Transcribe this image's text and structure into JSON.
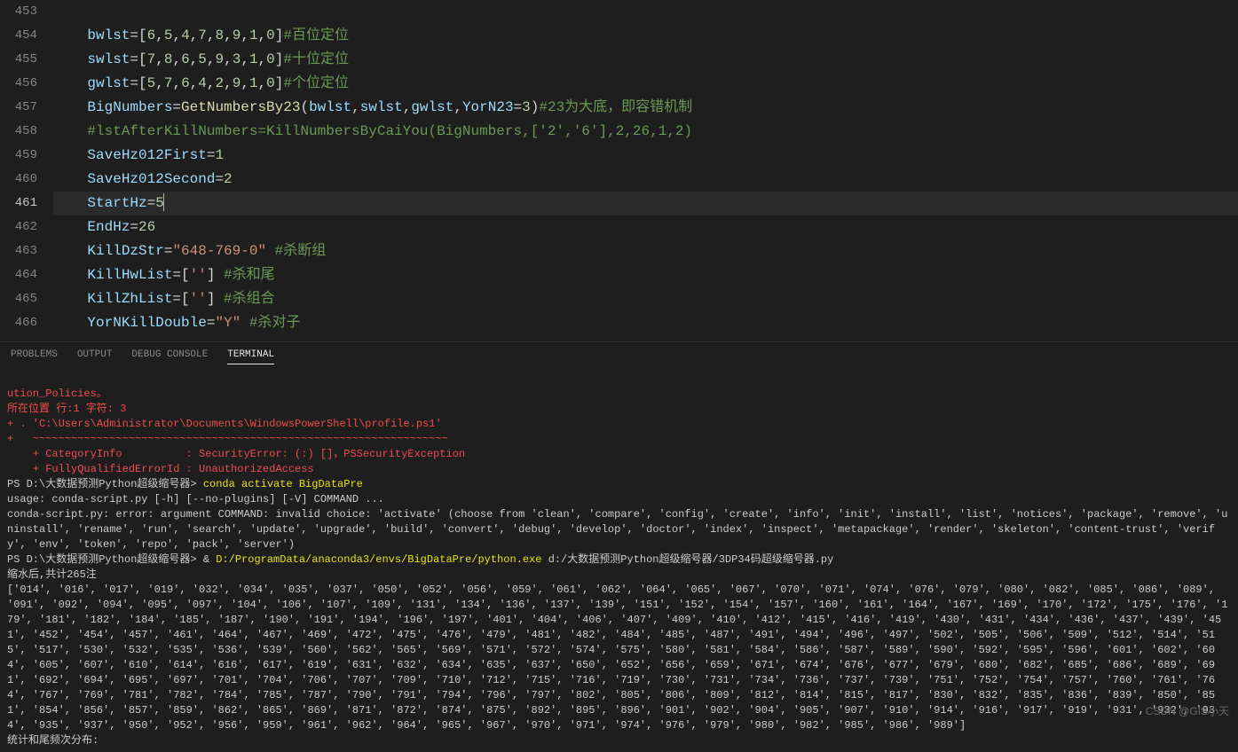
{
  "editor": {
    "lines": [
      {
        "num": "453",
        "tokens": []
      },
      {
        "num": "454",
        "tokens": [
          {
            "t": "bwlst",
            "c": "tk-var"
          },
          {
            "t": "=[",
            "c": "tk-op"
          },
          {
            "t": "6",
            "c": "tk-num"
          },
          {
            "t": ",",
            "c": "tk-op"
          },
          {
            "t": "5",
            "c": "tk-num"
          },
          {
            "t": ",",
            "c": "tk-op"
          },
          {
            "t": "4",
            "c": "tk-num"
          },
          {
            "t": ",",
            "c": "tk-op"
          },
          {
            "t": "7",
            "c": "tk-num"
          },
          {
            "t": ",",
            "c": "tk-op"
          },
          {
            "t": "8",
            "c": "tk-num"
          },
          {
            "t": ",",
            "c": "tk-op"
          },
          {
            "t": "9",
            "c": "tk-num"
          },
          {
            "t": ",",
            "c": "tk-op"
          },
          {
            "t": "1",
            "c": "tk-num"
          },
          {
            "t": ",",
            "c": "tk-op"
          },
          {
            "t": "0",
            "c": "tk-num"
          },
          {
            "t": "]",
            "c": "tk-op"
          },
          {
            "t": "#百位定位",
            "c": "tk-cmt"
          }
        ]
      },
      {
        "num": "455",
        "tokens": [
          {
            "t": "swlst",
            "c": "tk-var"
          },
          {
            "t": "=[",
            "c": "tk-op"
          },
          {
            "t": "7",
            "c": "tk-num"
          },
          {
            "t": ",",
            "c": "tk-op"
          },
          {
            "t": "8",
            "c": "tk-num"
          },
          {
            "t": ",",
            "c": "tk-op"
          },
          {
            "t": "6",
            "c": "tk-num"
          },
          {
            "t": ",",
            "c": "tk-op"
          },
          {
            "t": "5",
            "c": "tk-num"
          },
          {
            "t": ",",
            "c": "tk-op"
          },
          {
            "t": "9",
            "c": "tk-num"
          },
          {
            "t": ",",
            "c": "tk-op"
          },
          {
            "t": "3",
            "c": "tk-num"
          },
          {
            "t": ",",
            "c": "tk-op"
          },
          {
            "t": "1",
            "c": "tk-num"
          },
          {
            "t": ",",
            "c": "tk-op"
          },
          {
            "t": "0",
            "c": "tk-num"
          },
          {
            "t": "]",
            "c": "tk-op"
          },
          {
            "t": "#十位定位",
            "c": "tk-cmt"
          }
        ]
      },
      {
        "num": "456",
        "tokens": [
          {
            "t": "gwlst",
            "c": "tk-var"
          },
          {
            "t": "=[",
            "c": "tk-op"
          },
          {
            "t": "5",
            "c": "tk-num"
          },
          {
            "t": ",",
            "c": "tk-op"
          },
          {
            "t": "7",
            "c": "tk-num"
          },
          {
            "t": ",",
            "c": "tk-op"
          },
          {
            "t": "6",
            "c": "tk-num"
          },
          {
            "t": ",",
            "c": "tk-op"
          },
          {
            "t": "4",
            "c": "tk-num"
          },
          {
            "t": ",",
            "c": "tk-op"
          },
          {
            "t": "2",
            "c": "tk-num"
          },
          {
            "t": ",",
            "c": "tk-op"
          },
          {
            "t": "9",
            "c": "tk-num"
          },
          {
            "t": ",",
            "c": "tk-op"
          },
          {
            "t": "1",
            "c": "tk-num"
          },
          {
            "t": ",",
            "c": "tk-op"
          },
          {
            "t": "0",
            "c": "tk-num"
          },
          {
            "t": "]",
            "c": "tk-op"
          },
          {
            "t": "#个位定位",
            "c": "tk-cmt"
          }
        ]
      },
      {
        "num": "457",
        "tokens": [
          {
            "t": "BigNumbers",
            "c": "tk-var"
          },
          {
            "t": "=",
            "c": "tk-op"
          },
          {
            "t": "GetNumbersBy23",
            "c": "tk-fn"
          },
          {
            "t": "(",
            "c": "tk-op"
          },
          {
            "t": "bwlst",
            "c": "tk-var"
          },
          {
            "t": ",",
            "c": "tk-op"
          },
          {
            "t": "swlst",
            "c": "tk-var"
          },
          {
            "t": ",",
            "c": "tk-op"
          },
          {
            "t": "gwlst",
            "c": "tk-var"
          },
          {
            "t": ",",
            "c": "tk-op"
          },
          {
            "t": "YorN23",
            "c": "tk-param"
          },
          {
            "t": "=",
            "c": "tk-op"
          },
          {
            "t": "3",
            "c": "tk-num"
          },
          {
            "t": ")",
            "c": "tk-op"
          },
          {
            "t": "#23为大底，即容错机制",
            "c": "tk-cmt"
          }
        ]
      },
      {
        "num": "458",
        "tokens": [
          {
            "t": "#lstAfterKillNumbers=KillNumbersByCaiYou(BigNumbers,['2','6'],2,26,1,2)",
            "c": "tk-cmt"
          }
        ]
      },
      {
        "num": "459",
        "tokens": [
          {
            "t": "SaveHz012First",
            "c": "tk-var"
          },
          {
            "t": "=",
            "c": "tk-op"
          },
          {
            "t": "1",
            "c": "tk-num"
          }
        ]
      },
      {
        "num": "460",
        "tokens": [
          {
            "t": "SaveHz012Second",
            "c": "tk-var"
          },
          {
            "t": "=",
            "c": "tk-op"
          },
          {
            "t": "2",
            "c": "tk-num"
          }
        ]
      },
      {
        "num": "461",
        "active": true,
        "tokens": [
          {
            "t": "StartHz",
            "c": "tk-var"
          },
          {
            "t": "=",
            "c": "tk-op"
          },
          {
            "t": "5",
            "c": "tk-num"
          }
        ]
      },
      {
        "num": "462",
        "tokens": [
          {
            "t": "EndHz",
            "c": "tk-var"
          },
          {
            "t": "=",
            "c": "tk-op"
          },
          {
            "t": "26",
            "c": "tk-num"
          }
        ]
      },
      {
        "num": "463",
        "tokens": [
          {
            "t": "KillDzStr",
            "c": "tk-var"
          },
          {
            "t": "=",
            "c": "tk-op"
          },
          {
            "t": "\"648-769-0\"",
            "c": "tk-str"
          },
          {
            "t": " ",
            "c": "tk-op"
          },
          {
            "t": "#杀断组",
            "c": "tk-cmt"
          }
        ]
      },
      {
        "num": "464",
        "tokens": [
          {
            "t": "KillHwList",
            "c": "tk-var"
          },
          {
            "t": "=[",
            "c": "tk-op"
          },
          {
            "t": "''",
            "c": "tk-str"
          },
          {
            "t": "] ",
            "c": "tk-op"
          },
          {
            "t": "#杀和尾",
            "c": "tk-cmt"
          }
        ]
      },
      {
        "num": "465",
        "tokens": [
          {
            "t": "KillZhList",
            "c": "tk-var"
          },
          {
            "t": "=[",
            "c": "tk-op"
          },
          {
            "t": "''",
            "c": "tk-str"
          },
          {
            "t": "] ",
            "c": "tk-op"
          },
          {
            "t": "#杀组合",
            "c": "tk-cmt"
          }
        ]
      },
      {
        "num": "466",
        "tokens": [
          {
            "t": "YorNKillDouble",
            "c": "tk-var"
          },
          {
            "t": "=",
            "c": "tk-op"
          },
          {
            "t": "\"Y\"",
            "c": "tk-str"
          },
          {
            "t": " ",
            "c": "tk-op"
          },
          {
            "t": "#杀对子",
            "c": "tk-cmt"
          }
        ]
      }
    ]
  },
  "panel": {
    "tabs": [
      {
        "label": "PROBLEMS",
        "active": false
      },
      {
        "label": "OUTPUT",
        "active": false
      },
      {
        "label": "DEBUG CONSOLE",
        "active": false
      },
      {
        "label": "TERMINAL",
        "active": true
      }
    ]
  },
  "terminal": {
    "err1": "ution_Policies。",
    "err2": "所在位置 行:1 字符: 3",
    "err3": "+ . 'C:\\Users\\Administrator\\Documents\\WindowsPowerShell\\profile.ps1'",
    "err4": "+   ~~~~~~~~~~~~~~~~~~~~~~~~~~~~~~~~~~~~~~~~~~~~~~~~~~~~~~~~~~~~~~~~~",
    "err5": "    + CategoryInfo          : SecurityError: (:) []，PSSecurityException",
    "err6": "    + FullyQualifiedErrorId : UnauthorizedAccess",
    "ps1a": "PS D:\\大数据预测Python超级缩号器> ",
    "ps1b": "conda activate BigDataPre",
    "usage": "usage: conda-script.py [-h] [--no-plugins] [-V] COMMAND ...",
    "condaerr": "conda-script.py: error: argument COMMAND: invalid choice: 'activate' (choose from 'clean', 'compare', 'config', 'create', 'info', 'init', 'install', 'list', 'notices', 'package', 'remove', 'uninstall', 'rename', 'run', 'search', 'update', 'upgrade', 'build', 'convert', 'debug', 'develop', 'doctor', 'index', 'inspect', 'metapackage', 'render', 'skeleton', 'content-trust', 'verify', 'env', 'token', 'repo', 'pack', 'server')",
    "ps2a": "PS D:\\大数据预测Python超级缩号器> & ",
    "ps2b": "D:/ProgramData/anaconda3/envs/BigDataPre/python.exe",
    "ps2c": " d:/大数据预测Python超级缩号器/3DP34码超级缩号器.py",
    "res1": "缩水后,共计265注",
    "res2": "['014', '016', '017', '019', '032', '034', '035', '037', '050', '052', '056', '059', '061', '062', '064', '065', '067', '070', '071', '074', '076', '079', '080', '082', '085', '086', '089', '091', '092', '094', '095', '097', '104', '106', '107', '109', '131', '134', '136', '137', '139', '151', '152', '154', '157', '160', '161', '164', '167', '169', '170', '172', '175', '176', '179', '181', '182', '184', '185', '187', '190', '191', '194', '196', '197', '401', '404', '406', '407', '409', '410', '412', '415', '416', '419', '430', '431', '434', '436', '437', '439', '451', '452', '454', '457', '461', '464', '467', '469', '472', '475', '476', '479', '481', '482', '484', '485', '487', '491', '494', '496', '497', '502', '505', '506', '509', '512', '514', '515', '517', '530', '532', '535', '536', '539', '560', '562', '565', '569', '571', '572', '574', '575', '580', '581', '584', '586', '587', '589', '590', '592', '595', '596', '601', '602', '604', '605', '607', '610', '614', '616', '617', '619', '631', '632', '634', '635', '637', '650', '652', '656', '659', '671', '674', '676', '677', '679', '680', '682', '685', '686', '689', '691', '692', '694', '695', '697', '701', '704', '706', '707', '709', '710', '712', '715', '716', '719', '730', '731', '734', '736', '737', '739', '751', '752', '754', '757', '760', '761', '764', '767', '769', '781', '782', '784', '785', '787', '790', '791', '794', '796', '797', '802', '805', '806', '809', '812', '814', '815', '817', '830', '832', '835', '836', '839', '850', '851', '854', '856', '857', '859', '862', '865', '869', '871', '872', '874', '875', '892', '895', '896', '901', '902', '904', '905', '907', '910', '914', '916', '917', '919', '931', '932', '934', '935', '937', '950', '952', '956', '959', '961', '962', '964', '965', '967', '970', '971', '974', '976', '979', '980', '982', '985', '986', '989']",
    "res3": "统计和尾频次分布:"
  },
  "watermark": "CSDN @GIS小天"
}
